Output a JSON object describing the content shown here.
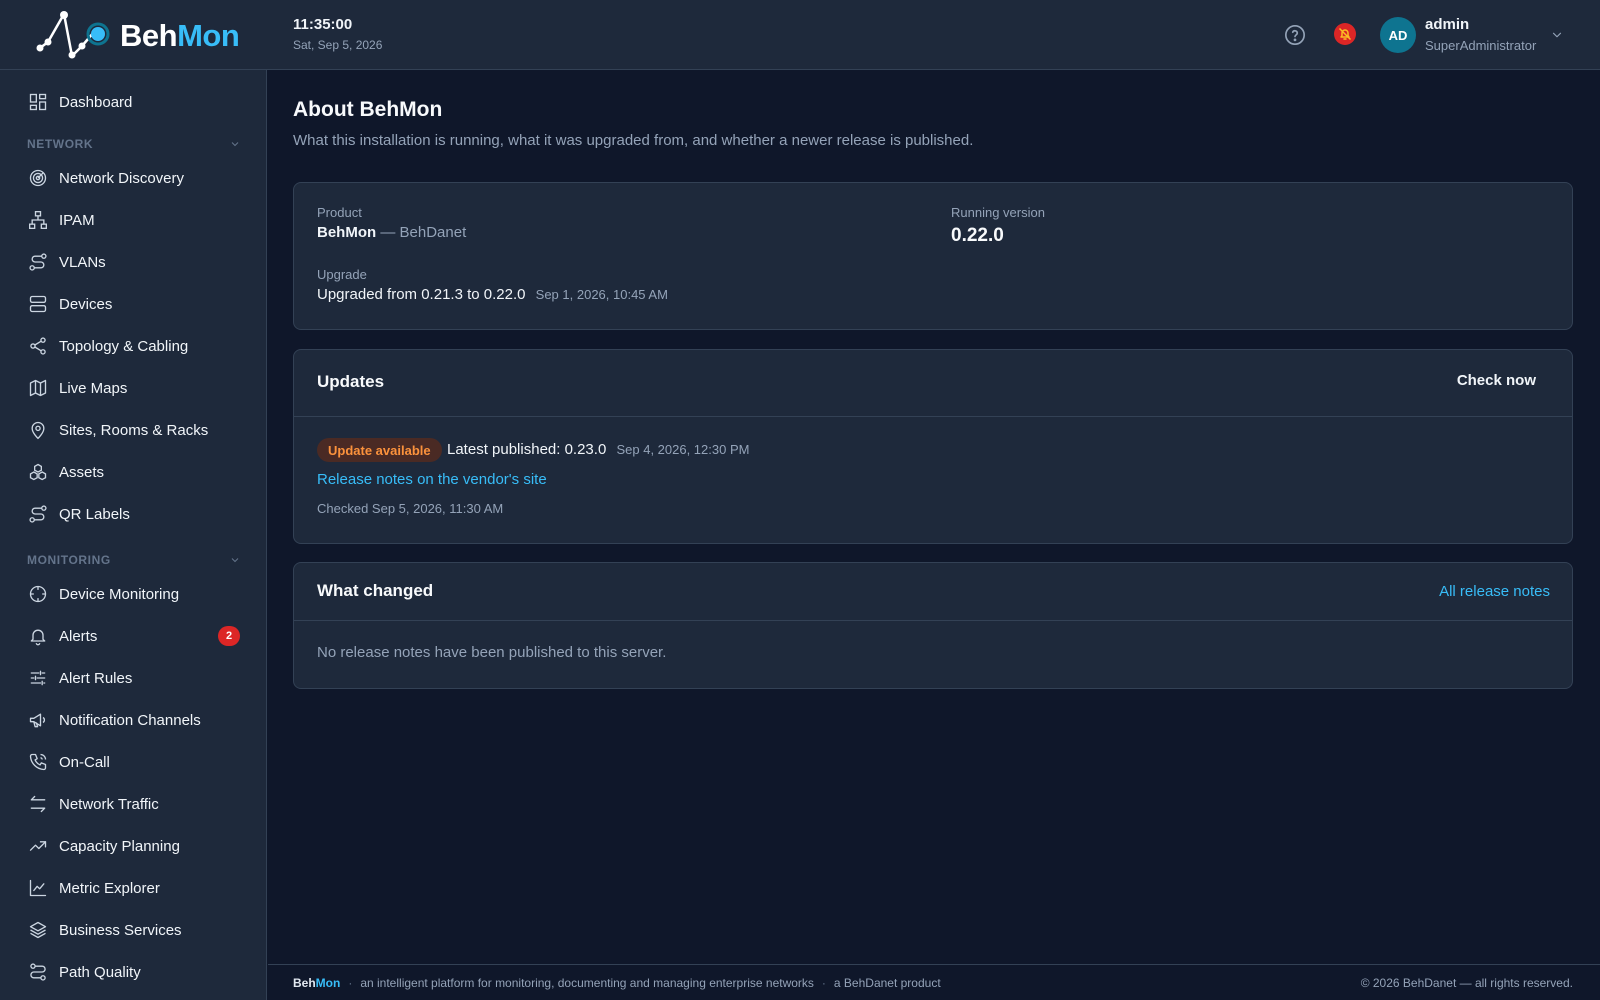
{
  "app": {
    "name_part1": "Beh",
    "name_part2": "Mon",
    "time": "11:35:00",
    "date": "Sat, Sep 5, 2026"
  },
  "user": {
    "initials": "AD",
    "name": "admin",
    "role": "SuperAdministrator"
  },
  "sidebar": {
    "dashboard": "Dashboard",
    "network_section": "NETWORK",
    "network_items": [
      {
        "label": "Network Discovery",
        "icon": "radar-icon"
      },
      {
        "label": "IPAM",
        "icon": "network-tree-icon"
      },
      {
        "label": "VLANs",
        "icon": "route-icon"
      },
      {
        "label": "Devices",
        "icon": "server-icon"
      },
      {
        "label": "Topology & Cabling",
        "icon": "share-nodes-icon"
      },
      {
        "label": "Live Maps",
        "icon": "map-icon"
      },
      {
        "label": "Sites, Rooms & Racks",
        "icon": "map-pin-icon"
      },
      {
        "label": "Assets",
        "icon": "boxes-icon"
      },
      {
        "label": "QR Labels",
        "icon": "route-icon"
      }
    ],
    "monitoring_section": "MONITORING",
    "monitoring_items": [
      {
        "label": "Device Monitoring",
        "icon": "crosshair-icon"
      },
      {
        "label": "Alerts",
        "icon": "bell-icon",
        "badge": "2"
      },
      {
        "label": "Alert Rules",
        "icon": "sliders-icon"
      },
      {
        "label": "Notification Channels",
        "icon": "megaphone-icon"
      },
      {
        "label": "On-Call",
        "icon": "phone-icon"
      },
      {
        "label": "Network Traffic",
        "icon": "arrows-swap-icon"
      },
      {
        "label": "Capacity Planning",
        "icon": "trending-up-icon"
      },
      {
        "label": "Metric Explorer",
        "icon": "line-chart-icon"
      },
      {
        "label": "Business Services",
        "icon": "layers-icon"
      },
      {
        "label": "Path Quality",
        "icon": "path-icon"
      }
    ]
  },
  "page": {
    "title": "About BehMon",
    "subtitle": "What this installation is running, what it was upgraded from, and whether a newer release is published."
  },
  "about": {
    "product_label": "Product",
    "product_name": "BehMon",
    "product_sep": " — ",
    "product_vendor": "BehDanet",
    "running_label": "Running version",
    "running_version": "0.22.0",
    "upgrade_label": "Upgrade",
    "upgrade_text": "Upgraded from 0.21.3 to 0.22.0",
    "upgrade_date": "Sep 1, 2026, 10:45 AM"
  },
  "updates": {
    "title": "Updates",
    "check_button": "Check now",
    "badge": "Update available",
    "latest_text": "Latest published: 0.23.0",
    "latest_date": "Sep 4, 2026, 12:30 PM",
    "release_link": "Release notes on the vendor's site",
    "checked_text": "Checked Sep 5, 2026, 11:30 AM"
  },
  "changes": {
    "title": "What changed",
    "all_link": "All release notes",
    "empty_text": "No release notes have been published to this server."
  },
  "footer": {
    "brand_part1": "Beh",
    "brand_part2": "Mon",
    "tagline": "an intelligent platform for monitoring, documenting and managing enterprise networks",
    "product_of": "a BehDanet product",
    "copyright": "© 2026 BehDanet — all rights reserved."
  },
  "colors": {
    "accent": "#38bdf8",
    "background": "#0f172a",
    "panel": "#1e293b",
    "alert_badge": "#dc2626",
    "update_badge_text": "#fb923c"
  }
}
